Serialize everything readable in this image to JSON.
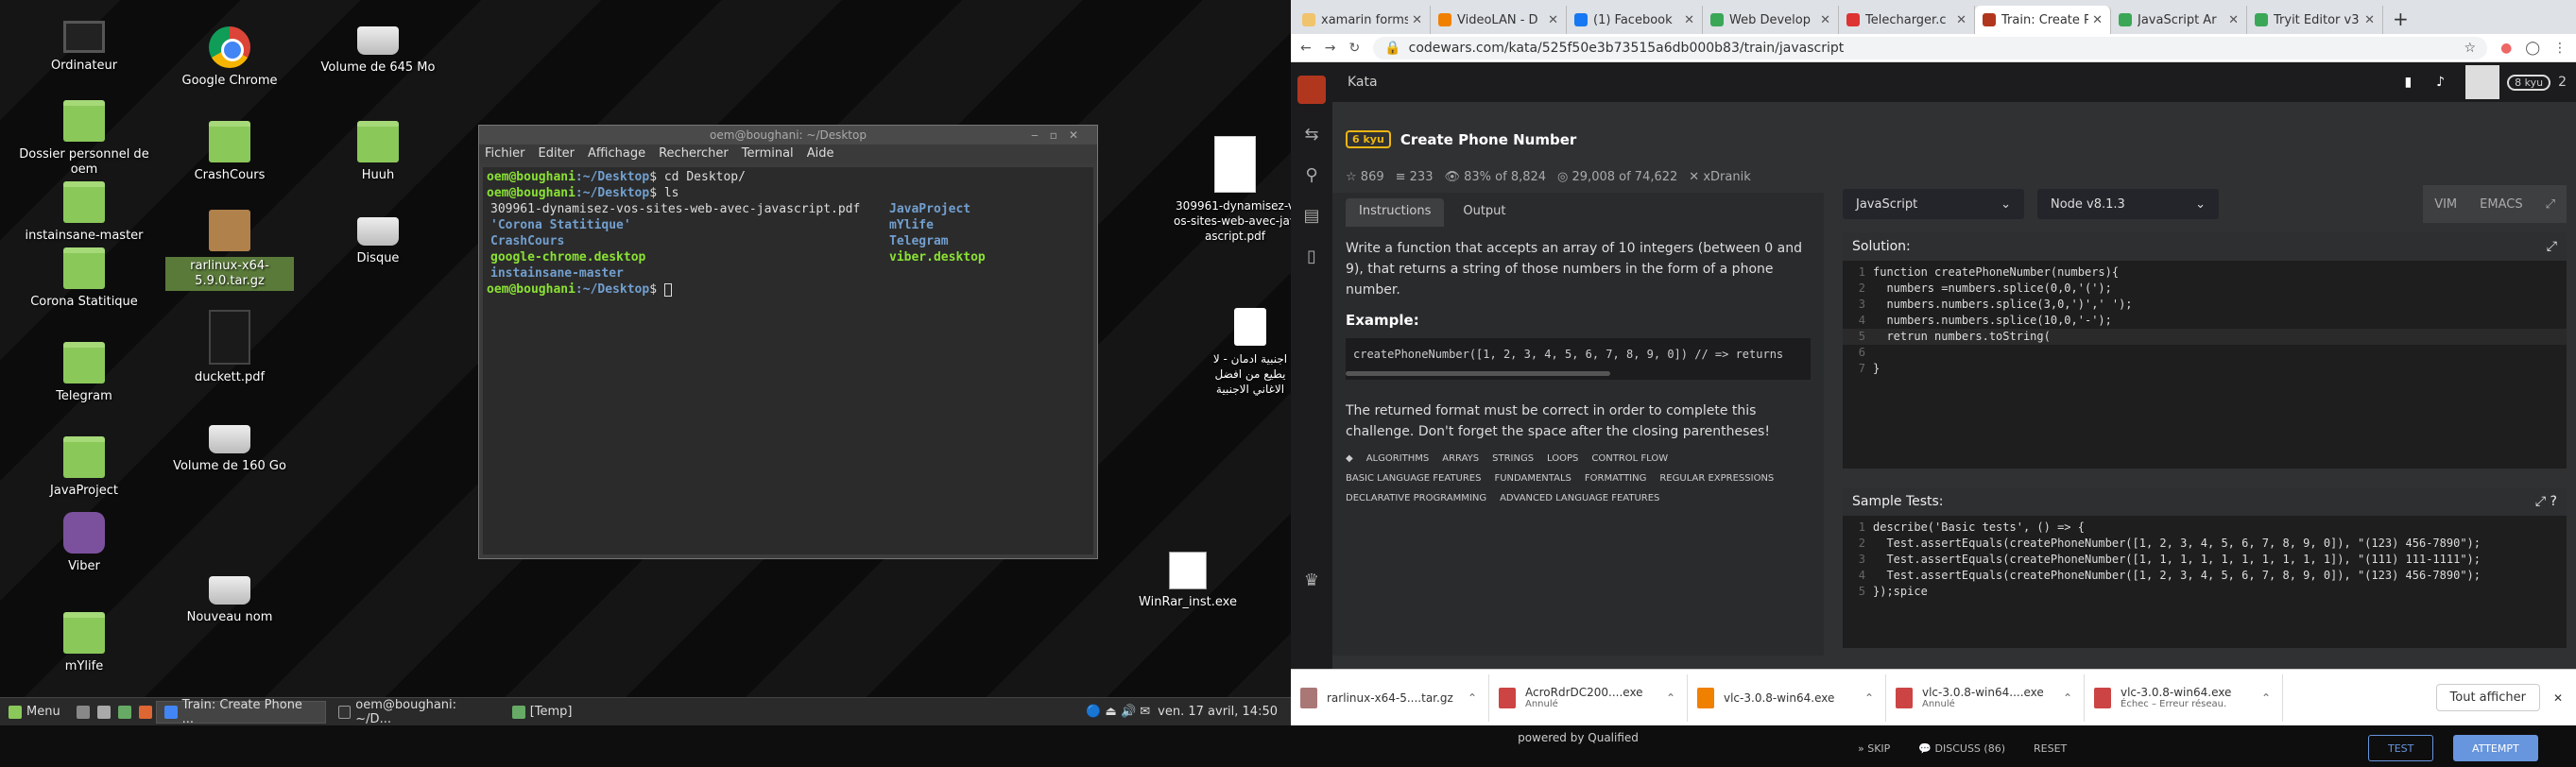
{
  "desktop": {
    "icons": [
      {
        "label": "Ordinateur",
        "type": "monitor"
      },
      {
        "label": "Dossier personnel de oem",
        "type": "folder"
      },
      {
        "label": "instainsane-master",
        "type": "folder"
      },
      {
        "label": "Corona Statitique",
        "type": "folder"
      },
      {
        "label": "Telegram",
        "type": "folder"
      },
      {
        "label": "JavaProject",
        "type": "folder"
      },
      {
        "label": "Viber",
        "type": "viber"
      },
      {
        "label": "mYlife",
        "type": "folder"
      },
      {
        "label": "Google Chrome",
        "type": "chrome"
      },
      {
        "label": "CrashCours",
        "type": "folder"
      },
      {
        "label": "rarlinux-x64-5.9.0.tar.gz",
        "type": "box"
      },
      {
        "label": "duckett.pdf",
        "type": "pdf"
      },
      {
        "label": "Volume de 160 Go",
        "type": "drive"
      },
      {
        "label": "Nouveau nom",
        "type": "drive"
      },
      {
        "label": "Volume de 645 Mo",
        "type": "drive"
      },
      {
        "label": "Huuh",
        "type": "folder"
      },
      {
        "label": "Disque",
        "type": "drive"
      },
      {
        "label": "309961-dynamisez-vos-sites-web-avec-javascript.pdf",
        "type": "pdf"
      },
      {
        "label": "اجنبية ادمان - لا يطيع من افضل الاغاني الاجنبية",
        "type": "mp3"
      },
      {
        "label": "WinRar_inst.exe",
        "type": "exe"
      }
    ]
  },
  "terminal": {
    "title": "oem@boughani: ~/Desktop",
    "menu": [
      "Fichier",
      "Editer",
      "Affichage",
      "Rechercher",
      "Terminal",
      "Aide"
    ],
    "prompt_user": "oem@boughani",
    "prompt_path": ":~/Desktop",
    "cmd1": "$ cd Desktop/",
    "cmd2": "$ ls",
    "ls_left": [
      "309961-dynamisez-vos-sites-web-avec-javascript.pdf",
      "'Corona Statitique'",
      "CrashCours",
      "google-chrome.desktop",
      "instainsane-master"
    ],
    "ls_right": [
      "JavaProject",
      "mYlife",
      "Telegram",
      "viber.desktop"
    ],
    "cmd3": "$ "
  },
  "taskbar": {
    "menu": "Menu",
    "items": [
      "Train: Create Phone ...",
      "oem@boughani: ~/D...",
      "[Temp]"
    ],
    "clock": "ven. 17 avril, 14:50"
  },
  "browser": {
    "tabs": [
      {
        "label": "xamarin forms",
        "color": "#f0c36d"
      },
      {
        "label": "VideoLAN - D",
        "color": "#f08000"
      },
      {
        "label": "(1) Facebook",
        "color": "#1877f2"
      },
      {
        "label": "Web Develop",
        "color": "#3aa757"
      },
      {
        "label": "Telecharger.c",
        "color": "#d33"
      },
      {
        "label": "Train: Create P",
        "color": "#b1361e"
      },
      {
        "label": "JavaScript Ar",
        "color": "#3aa757"
      },
      {
        "label": "Tryit Editor v3",
        "color": "#3aa757"
      }
    ],
    "url": "codewars.com/kata/525f50e3b73515a6db000b83/train/javascript"
  },
  "codewars": {
    "section": "Kata",
    "rank": "8 kyu",
    "honor": "2",
    "kyu": "6 kyu",
    "title": "Create Phone Number",
    "stars": "869",
    "collections": "233",
    "satisfaction": "83% of 8,824",
    "completed": "29,008 of 74,622",
    "author": "xDranik",
    "tabs": [
      "Instructions",
      "Output"
    ],
    "desc1": "Write a function that accepts an array of 10 integers (between 0 and 9), that returns a string of those numbers in the form of a phone number.",
    "example_heading": "Example:",
    "example_code": "createPhoneNumber([1, 2, 3, 4, 5, 6, 7, 8, 9, 0]) // => returns",
    "desc2": "The returned format must be correct in order to complete this challenge. Don't forget the space after the closing parentheses!",
    "tags": [
      "Algorithms",
      "Arrays",
      "Strings",
      "Loops",
      "Control Flow",
      "Basic Language Features",
      "Fundamentals",
      "Formatting",
      "Regular Expressions",
      "Declarative Programming",
      "Advanced Language Features"
    ],
    "powered_by": "powered by Qualified",
    "language": "JavaScript",
    "version": "Node v8.1.3",
    "modes": [
      "VIM",
      "EMACS"
    ],
    "solution_label": "Solution:",
    "solution_lines": [
      "function createPhoneNumber(numbers){",
      "  numbers =numbers.splice(0,0,'(');",
      "  numbers.numbers.splice(3,0,')',' ');",
      "  numbers.numbers.splice(10,0,'-');",
      "  retrun numbers.toString(",
      "",
      "}"
    ],
    "tests_label": "Sample Tests:",
    "test_lines": [
      "describe('Basic tests', () => {",
      "  Test.assertEquals(createPhoneNumber([1, 2, 3, 4, 5, 6, 7, 8, 9, 0]), \"(123) 456-7890\");",
      "  Test.assertEquals(createPhoneNumber([1, 1, 1, 1, 1, 1, 1, 1, 1, 1]), \"(111) 111-1111\");",
      "  Test.assertEquals(createPhoneNumber([1, 2, 3, 4, 5, 6, 7, 8, 9, 0]), \"(123) 456-7890\");",
      "});spice"
    ],
    "actions": [
      "SKIP",
      "DISCUSS (86)",
      "RESET"
    ],
    "test_btn": "TEST",
    "attempt_btn": "ATTEMPT"
  },
  "downloads": [
    {
      "name": "rarlinux-x64-5....tar.gz",
      "sub": ""
    },
    {
      "name": "AcroRdrDC200....exe",
      "sub": "Annulé"
    },
    {
      "name": "vlc-3.0.8-win64.exe",
      "sub": ""
    },
    {
      "name": "vlc-3.0.8-win64....exe",
      "sub": "Annulé"
    },
    {
      "name": "vlc-3.0.8-win64.exe",
      "sub": "Échec – Erreur réseau."
    }
  ],
  "downloads_show_all": "Tout afficher"
}
